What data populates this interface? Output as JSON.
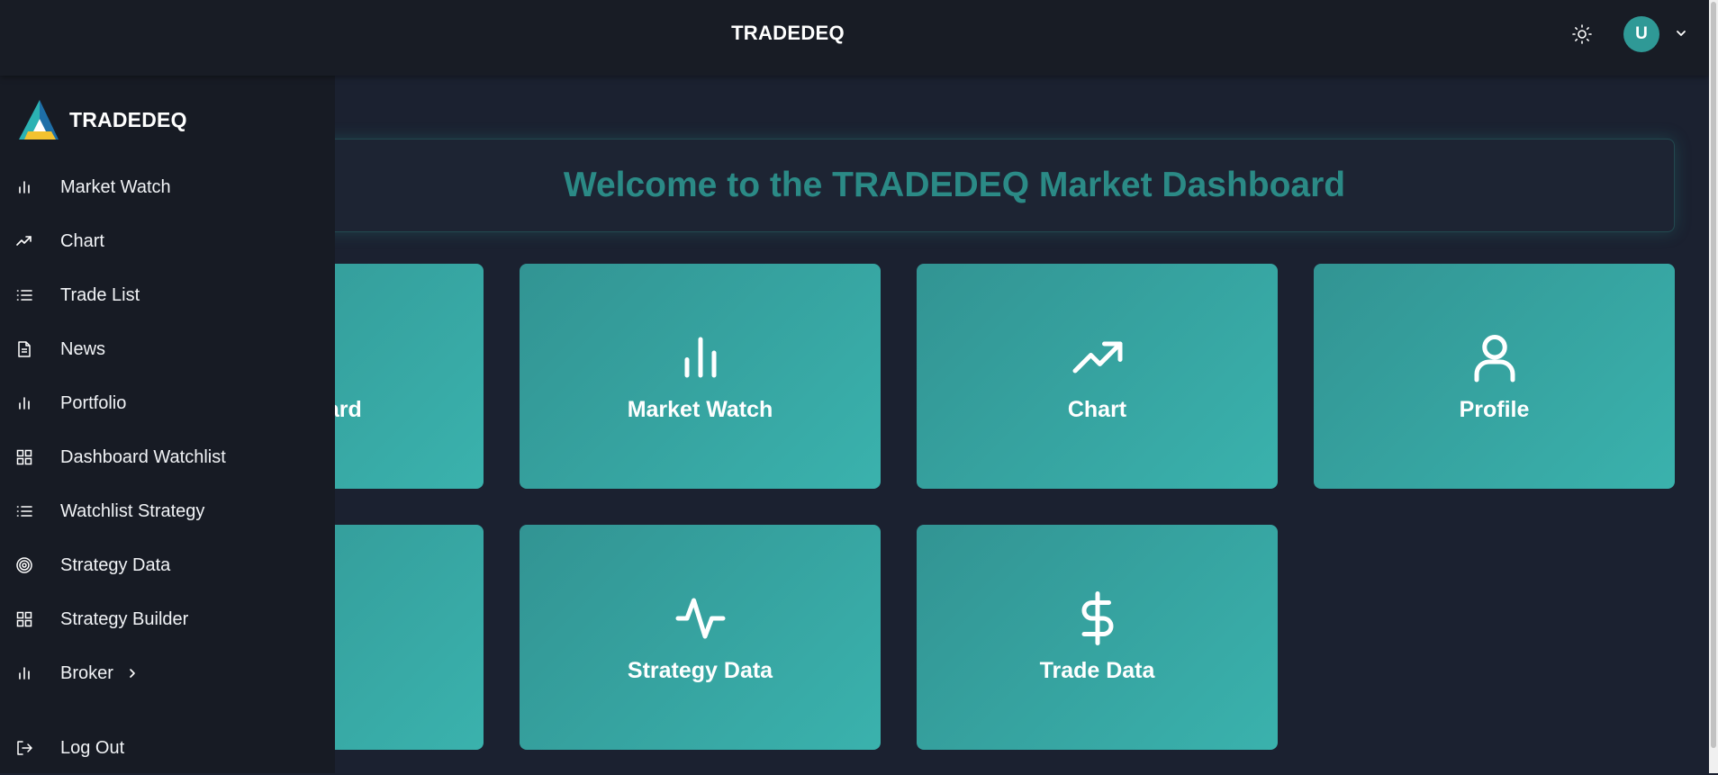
{
  "header": {
    "title": "TRADEDEQ",
    "avatar_initial": "U"
  },
  "welcome": {
    "heading": "Welcome to the TRADEDEQ Market Dashboard"
  },
  "cards": {
    "dashboard": "Dashboard",
    "market_watch": "Market Watch",
    "chart": "Chart",
    "profile": "Profile",
    "hidden_second_row": "",
    "strategy_data": "Strategy Data",
    "trade_data": "Trade Data"
  },
  "sidebar": {
    "brand": "TRADEDEQ",
    "items": [
      {
        "label": "Market Watch",
        "icon": "bar-chart-icon"
      },
      {
        "label": "Chart",
        "icon": "trending-up-icon"
      },
      {
        "label": "Trade List",
        "icon": "list-icon"
      },
      {
        "label": "News",
        "icon": "document-icon"
      },
      {
        "label": "Portfolio",
        "icon": "bar-chart-icon"
      },
      {
        "label": "Dashboard Watchlist",
        "icon": "grid-icon"
      },
      {
        "label": "Watchlist Strategy",
        "icon": "list-icon"
      },
      {
        "label": "Strategy Data",
        "icon": "target-icon"
      },
      {
        "label": "Strategy Builder",
        "icon": "grid-icon"
      },
      {
        "label": "Broker",
        "icon": "bar-chart-icon"
      }
    ],
    "logout": "Log Out"
  },
  "colors": {
    "accent": "#2f9996",
    "card_gradient_start": "#329493",
    "card_gradient_end": "#3ab2ad",
    "welcome_text": "#2b8a86",
    "background": "#1b2130",
    "sidebar": "#171b24"
  }
}
